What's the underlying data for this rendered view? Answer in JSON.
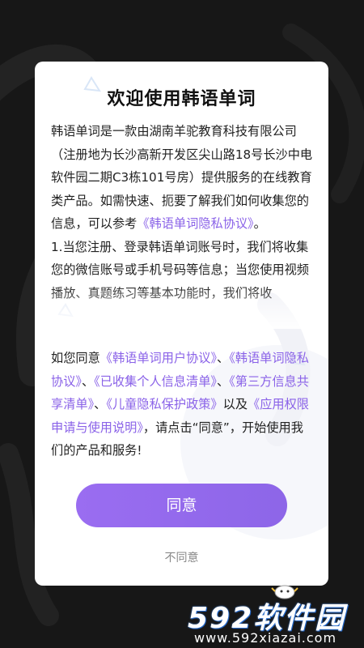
{
  "dialog": {
    "title": "欢迎使用韩语单词",
    "body_p1_pre": "韩语单词是一款由湖南羊驼教育科技有限公司（注册地为长沙高新开发区尖山路18号长沙中电软件园二期C3栋101号房）提供服务的在线教育类产品。如需快速、扼要了解我们如何收集您的信息，可以参考",
    "body_p1_link": "《韩语单词隐私协议》",
    "body_p1_post": "。",
    "body_p2": "1.当您注册、登录韩语单词账号时，我们将收集您的微信账号或手机号码等信息；当您使用视频播放、真题练习等基本功能时，我们将收",
    "consent": {
      "pre": "如您同意",
      "link_user_agreement": "《韩语单词用户协议》",
      "sep1": "、",
      "link_privacy_agreement": "《韩语单词隐私协议》",
      "sep2": "、",
      "link_collected_info": "《已收集个人信息清单》",
      "sep3": "、",
      "link_third_party": "《第三方信息共享清单》",
      "sep4": "、",
      "link_children_privacy": "《儿童隐私保护政策》",
      "mid": "以及",
      "link_permissions": "《应用权限申请与使用说明》",
      "post": "，请点击“同意”，开始使用我们的产品和服务!"
    },
    "agree_label": "同意",
    "disagree_label": "不同意"
  },
  "watermark": {
    "logo_text": "592软件园",
    "url": "www.592xiazai.com"
  },
  "colors": {
    "accent": "#8d66e8",
    "link": "#8a62e8",
    "background": "#171717",
    "dialog": "#ffffff"
  }
}
